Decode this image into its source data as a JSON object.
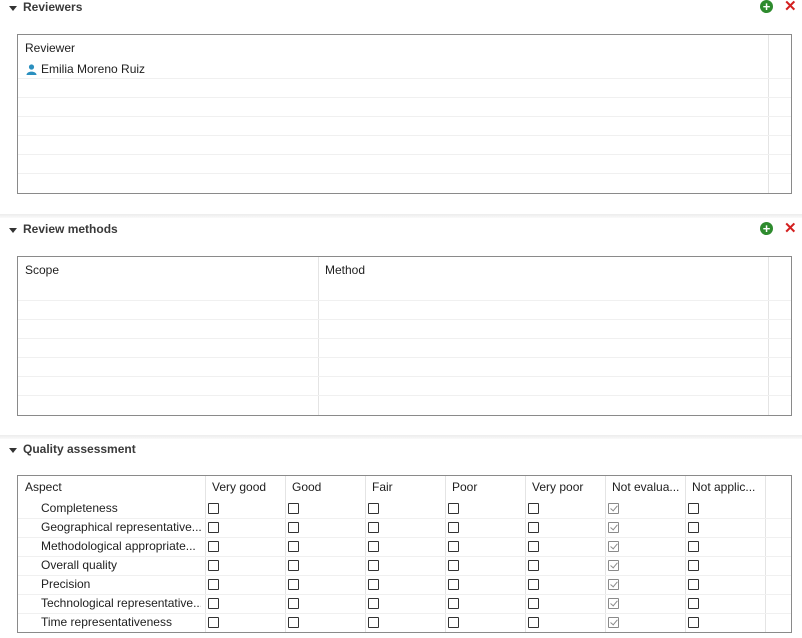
{
  "reviewers": {
    "title": "Reviewers",
    "column": "Reviewer",
    "rows": [
      "Emilia Moreno Ruiz"
    ]
  },
  "review_methods": {
    "title": "Review methods",
    "columns": [
      "Scope",
      "Method"
    ]
  },
  "quality_assessment": {
    "title": "Quality assessment",
    "columns": [
      "Aspect",
      "Very good",
      "Good",
      "Fair",
      "Poor",
      "Very poor",
      "Not evalua...",
      "Not applic..."
    ],
    "rows": [
      {
        "aspect": "Completeness",
        "checked": 5
      },
      {
        "aspect": "Geographical representative...",
        "checked": 5
      },
      {
        "aspect": "Methodological appropriate...",
        "checked": 5
      },
      {
        "aspect": "Overall quality",
        "checked": 5
      },
      {
        "aspect": "Precision",
        "checked": 5
      },
      {
        "aspect": "Technological representative...",
        "checked": 5
      },
      {
        "aspect": "Time representativeness",
        "checked": 5
      }
    ]
  },
  "icons": {
    "add": "plus-circle-icon",
    "remove": "x-icon",
    "user": "user-icon",
    "collapse": "chevron-down-icon"
  },
  "colors": {
    "add": "#2e8b2e",
    "remove": "#d32020",
    "user_icon": "#2a8fbf"
  }
}
